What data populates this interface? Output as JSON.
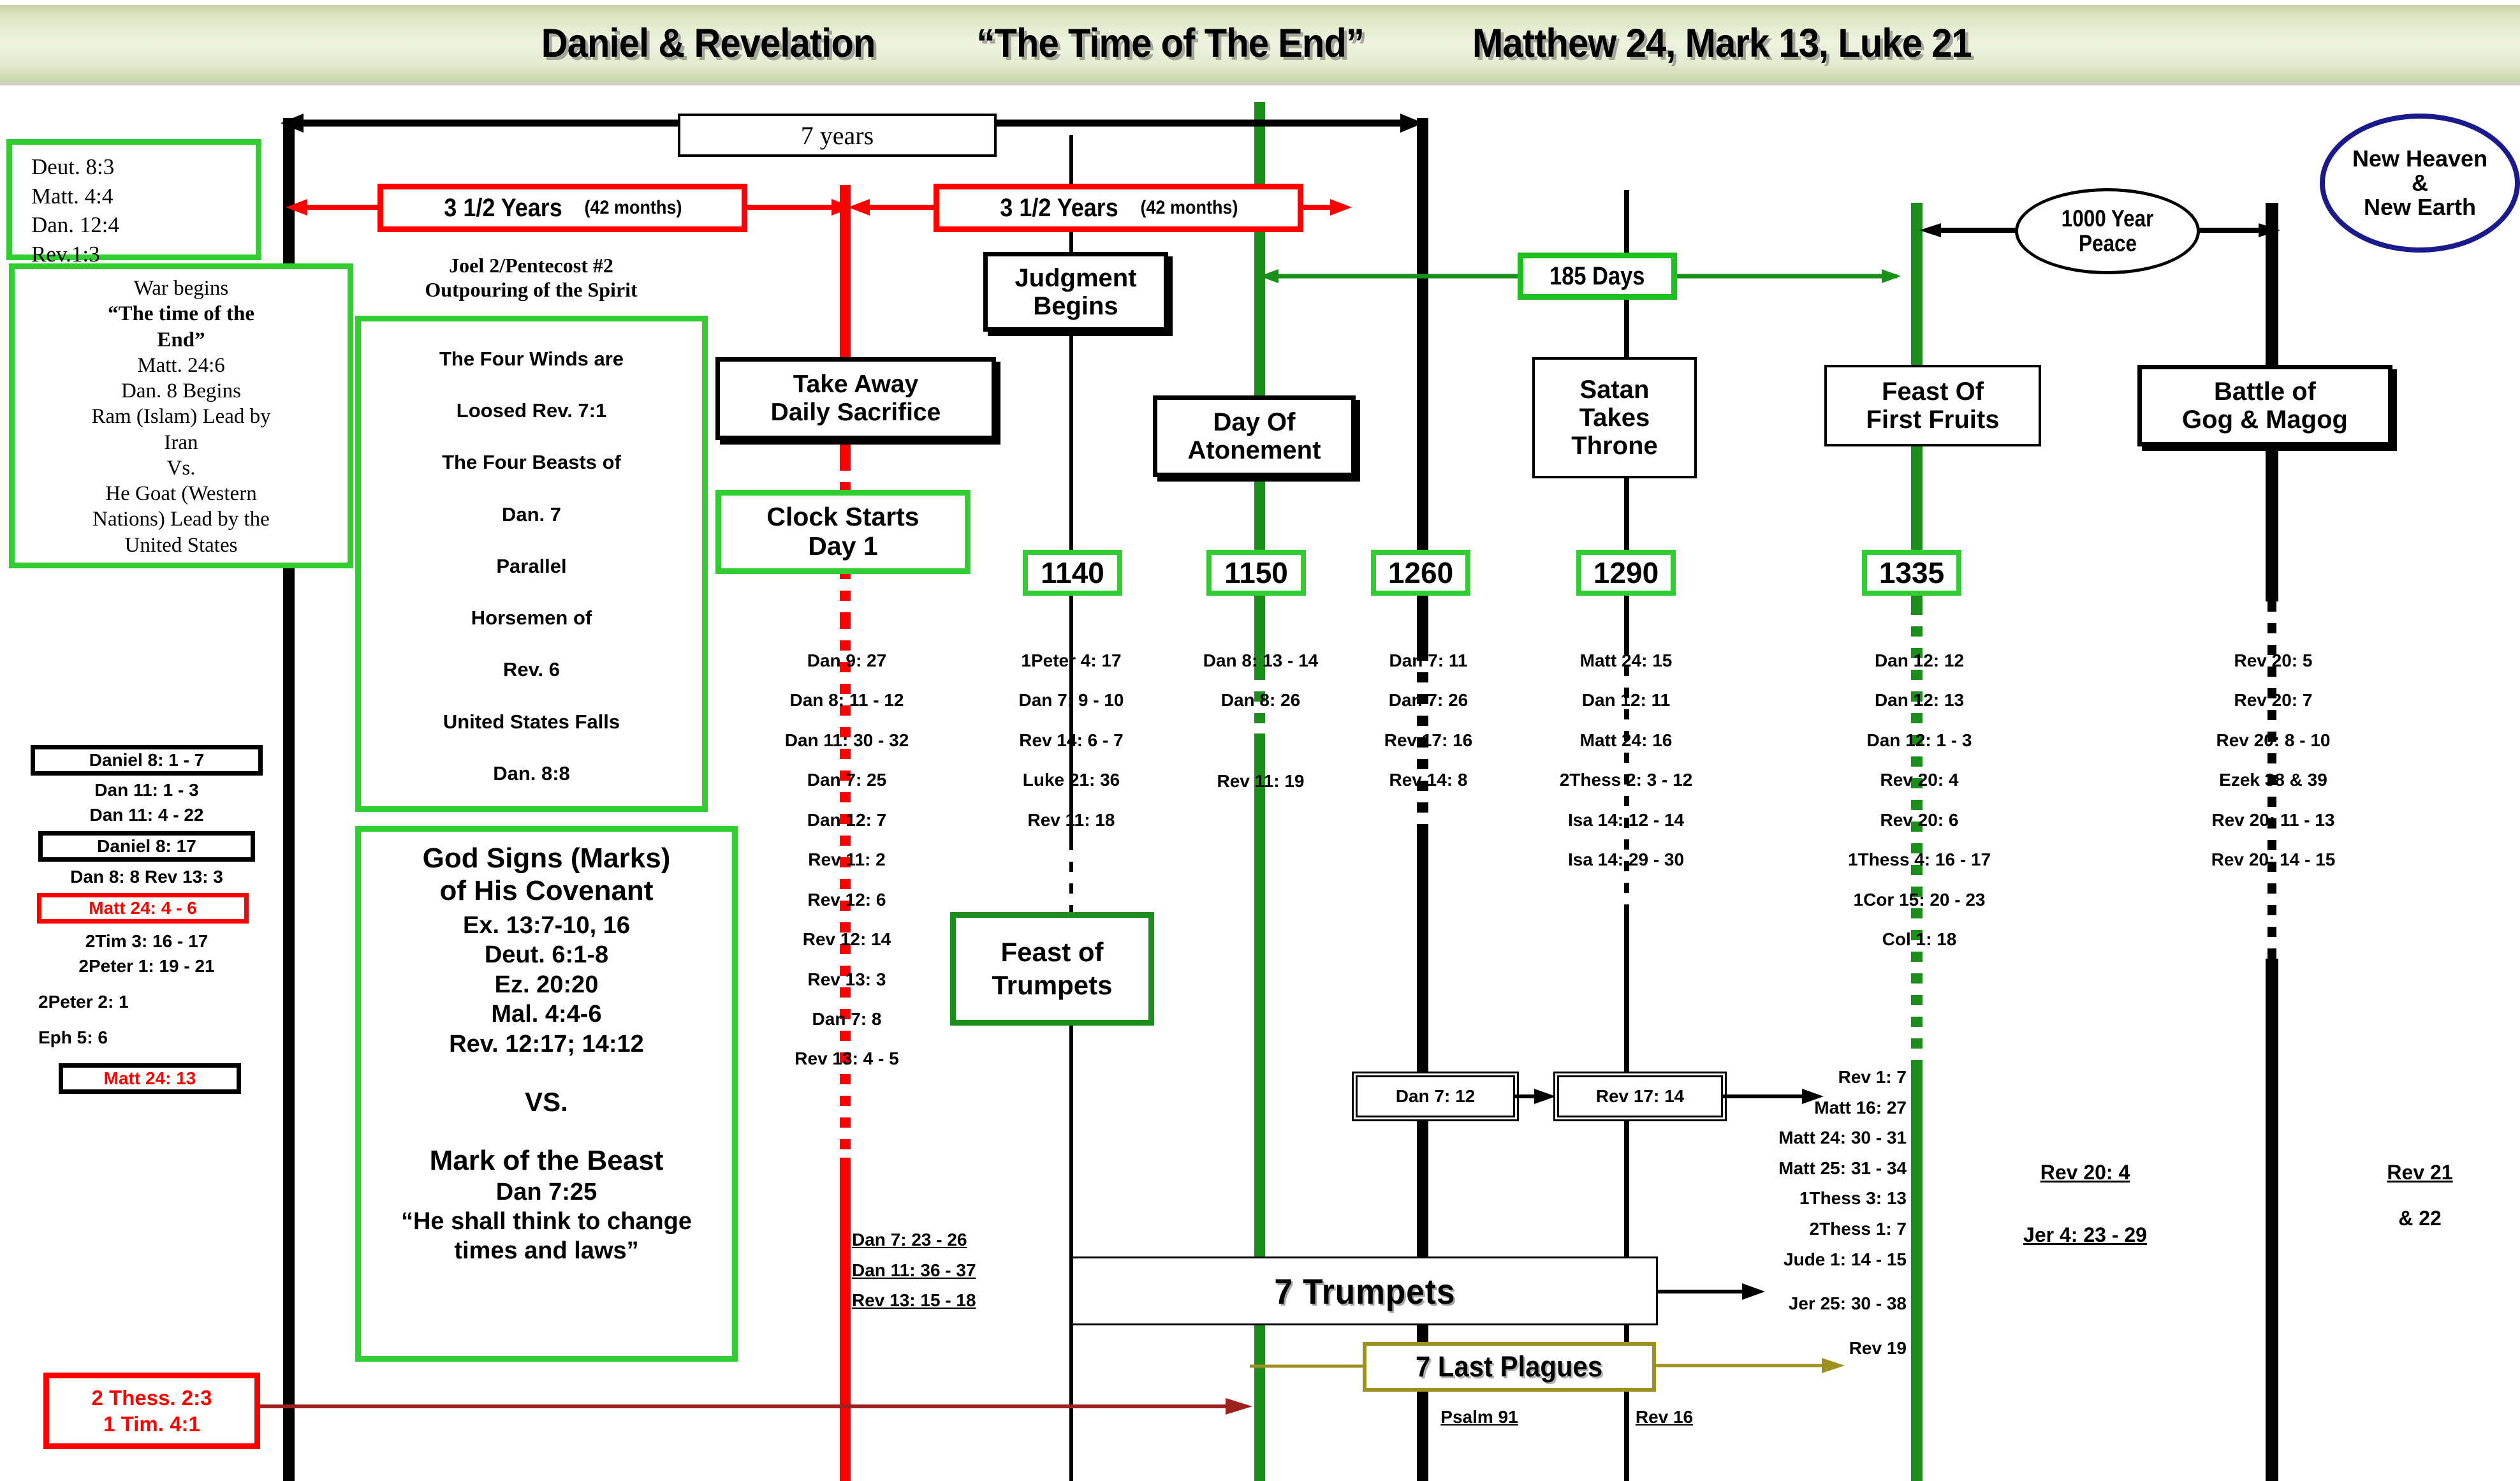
{
  "banner": {
    "left": "Daniel & Revelation",
    "center": "“The Time of The End”",
    "right": "Matthew 24, Mark 13, Luke 21"
  },
  "spans": {
    "seven_years": "7 years",
    "first_half": "3 1/2 Years",
    "first_half_sub": "(42 months)",
    "second_half": "3 1/2 Years",
    "second_half_sub": "(42 months)",
    "days_185": "185 Days",
    "thousand_year_peace": "1000 Year\nPeace",
    "peace_line1": "1000 Year",
    "peace_line2": "Peace"
  },
  "left_column": {
    "scripture_box": [
      "Deut. 8:3",
      "Matt. 4:4",
      "Dan. 12:4",
      "Rev.1:3"
    ],
    "war_box": [
      "War begins",
      "“The time of the",
      "End”",
      "Matt. 24:6",
      "Dan. 8 Begins",
      "Ram (Islam) Lead by",
      "Iran",
      "Vs.",
      "He Goat (Western",
      "Nations) Lead by the",
      "United States"
    ],
    "refs": [
      {
        "text": "Daniel 8: 1 - 7",
        "style": "black-box"
      },
      {
        "text": "Dan 11: 1 - 3",
        "style": "plain"
      },
      {
        "text": "Dan 11: 4 - 22",
        "style": "plain"
      },
      {
        "text": "Daniel 8: 17",
        "style": "black-box"
      },
      {
        "text": "Dan 8: 8   Rev 13: 3",
        "style": "plain"
      },
      {
        "text": "Matt  24: 4 - 6",
        "style": "red-box"
      },
      {
        "text": "2Tim  3: 16 - 17",
        "style": "plain"
      },
      {
        "text": "2Peter  1: 19 - 21",
        "style": "plain"
      },
      {
        "text": "2Peter  2: 1",
        "style": "plain"
      },
      {
        "text": "Eph  5: 6",
        "style": "plain"
      },
      {
        "text": "Matt  24: 13",
        "style": "black-box-red"
      }
    ],
    "bottom_red_box": [
      "2 Thess. 2:3",
      "1 Tim. 4:1"
    ]
  },
  "winds_column": {
    "caption": [
      "Joel 2/Pentecost #2",
      "Outpouring of the Spirit"
    ],
    "box_lines": [
      "The Four Winds are",
      "Loosed Rev. 7:1",
      "The Four Beasts of",
      "Dan. 7",
      "Parallel",
      "Horsemen of",
      "Rev. 6",
      "United States Falls",
      "Dan. 8:8"
    ],
    "covenant_title": [
      "God Signs (Marks)",
      "of His Covenant"
    ],
    "covenant_refs": [
      "Ex. 13:7-10, 16",
      "Deut. 6:1-8",
      "Ez. 20:20",
      "Mal. 4:4-6",
      "Rev. 12:17; 14:12"
    ],
    "vs": "VS.",
    "beast_title": "Mark of the Beast",
    "beast_refs": [
      "Dan 7:25",
      "“He shall think to change",
      "times and laws”"
    ]
  },
  "events": {
    "judgment_begins": [
      "Judgment",
      "Begins"
    ],
    "take_away": [
      "Take Away",
      "Daily Sacrifice"
    ],
    "clock_starts": [
      "Clock Starts",
      "Day 1"
    ],
    "day_of_atonement": [
      "Day Of",
      "Atonement"
    ],
    "satan_takes_throne": [
      "Satan",
      "Takes",
      "Throne"
    ],
    "feast_first_fruits": [
      "Feast Of",
      "First Fruits"
    ],
    "battle_gog_magog": [
      "Battle of",
      "Gog & Magog"
    ],
    "feast_of_trumpets": [
      "Feast of",
      "Trumpets"
    ],
    "new_heaven": [
      "New Heaven",
      "&",
      "New Earth"
    ],
    "seven_trumpets": "7 Trumpets",
    "seven_last_plagues": "7 Last Plagues"
  },
  "markers": {
    "m1140": "1140",
    "m1150": "1150",
    "m1260": "1260",
    "m1290": "1290",
    "m1335": "1335"
  },
  "columns": {
    "clock_start_refs": [
      "Dan  9: 27",
      "Dan   8: 11 - 12",
      "Dan 11: 30 - 32",
      "Dan  7: 25",
      "Dan  12: 7",
      "Rev 11: 2",
      "Rev 12: 6",
      "Rev 12: 14",
      "Rev 13: 3",
      "Dan  7: 8",
      "Rev 13: 4 - 5"
    ],
    "clock_start_underlined": [
      "Dan  7: 23 - 26",
      "Dan 11: 36 - 37",
      "Rev 13: 15 - 18"
    ],
    "refs_1140": [
      "1Peter  4: 17",
      "Dan  7: 9 - 10",
      "Rev 14: 6 - 7",
      "Luke  21: 36",
      "Rev  11: 18"
    ],
    "refs_1150": [
      "Dan 8: 13 - 14",
      "Dan 8: 26",
      "Rev  11: 19"
    ],
    "refs_1260": [
      "Dan  7: 11",
      "Dan  7: 26",
      "Rev 17: 16",
      "Rev  14: 8"
    ],
    "refs_1290": [
      "Matt 24: 15",
      "Dan 12: 11",
      "Matt 24: 16",
      "2Thess  2: 3 - 12",
      "Isa  14: 12 - 14",
      "Isa  14: 29 - 30"
    ],
    "refs_1335": [
      "Dan 12: 12",
      "Dan 12: 13",
      "Dan 12: 1 - 3",
      "Rev  20: 4",
      "Rev 20: 6",
      "1Thess  4: 16 - 17",
      "1Cor  15: 20 - 23",
      "Col  1: 18"
    ],
    "refs_after_1335": [
      "Rev 1: 7",
      "Matt 16: 27",
      "Matt 24: 30 - 31",
      "Matt 25: 31 - 34",
      "1Thess 3: 13",
      "2Thess 1: 7",
      "Jude 1: 14 - 15",
      "Jer 25: 30 - 38",
      "Rev 19"
    ],
    "refs_gog": [
      "Rev 20: 5",
      "Rev 20: 7",
      "Rev 20: 8 - 10",
      "Ezek 38 & 39",
      "Rev 20: 11 - 13",
      "Rev 20: 14 - 15"
    ],
    "flow_boxes": [
      "Dan  7: 12",
      "Rev  17: 14"
    ],
    "bottom_refs": {
      "psalm91": "Psalm 91",
      "rev16": "Rev 16",
      "rev20_4": "Rev 20: 4",
      "jer4": "Jer 4: 23 - 29",
      "rev21": "Rev 21",
      "rev22": "& 22"
    }
  },
  "colors": {
    "green": "#32cd32",
    "dark_green": "#1a8f1a",
    "red": "#ff0000",
    "dark_red": "#a02020",
    "olive": "#a09020",
    "navy": "#1a1a8c",
    "black": "#000000"
  }
}
